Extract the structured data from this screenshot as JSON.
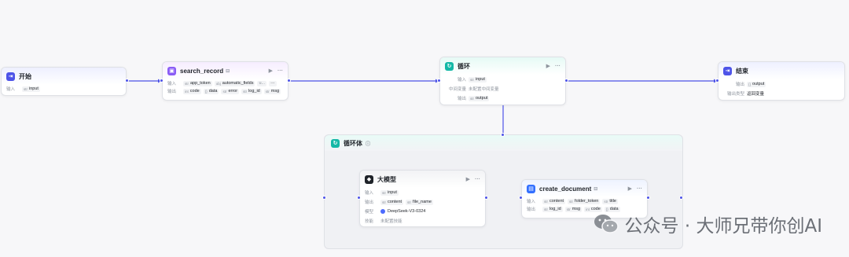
{
  "colors": {
    "edge": "#4d53e8",
    "accent": "#4d53e8"
  },
  "nodes": {
    "start": {
      "title": "开始",
      "input_label": "输入",
      "inputs": [
        {
          "type": "str",
          "name": "input"
        }
      ]
    },
    "search": {
      "title": "search_record",
      "input_label": "输入",
      "output_label": "输出",
      "inputs": [
        {
          "type": "str",
          "name": "app_token"
        },
        {
          "type": "obj",
          "name": "automatic_fields"
        },
        {
          "type": "",
          "name": "u..."
        }
      ],
      "more": "···",
      "outputs": [
        {
          "type": "int",
          "name": "code"
        },
        {
          "type": "{}",
          "name": "data"
        },
        {
          "type": "str",
          "name": "error"
        },
        {
          "type": "str",
          "name": "log_id"
        },
        {
          "type": "str",
          "name": "msg"
        }
      ]
    },
    "loop": {
      "title": "循环",
      "input_label": "输入",
      "mid_label": "中间变量",
      "mid_value": "未配置中间变量",
      "output_label": "输出",
      "inputs": [
        {
          "type": "str",
          "name": "input"
        }
      ],
      "outputs": [
        {
          "type": "str",
          "name": "output"
        }
      ]
    },
    "end": {
      "title": "结束",
      "output_label": "输出",
      "outputs": [
        {
          "type": "{}",
          "name": "output"
        }
      ],
      "return_label": "输出类型",
      "return_value": "返回变量"
    },
    "loop_body": {
      "title": "循环体"
    },
    "llm": {
      "title": "大模型",
      "input_label": "输入",
      "output_label": "输出",
      "model_label": "模型",
      "skill_label": "技能",
      "inputs": [
        {
          "type": "str",
          "name": "input"
        }
      ],
      "outputs": [
        {
          "type": "str",
          "name": "content"
        },
        {
          "type": "str",
          "name": "file_name"
        }
      ],
      "model": "DeepSeek-V3-0324",
      "skill": "未配置技能"
    },
    "doc": {
      "title": "create_document",
      "input_label": "输入",
      "output_label": "输出",
      "inputs": [
        {
          "type": "str",
          "name": "content"
        },
        {
          "type": "str",
          "name": "folder_token"
        },
        {
          "type": "str",
          "name": "title"
        }
      ],
      "outputs": [
        {
          "type": "str",
          "name": "log_id"
        },
        {
          "type": "str",
          "name": "msg"
        },
        {
          "type": "int",
          "name": "code"
        },
        {
          "type": "{}",
          "name": "data"
        }
      ]
    }
  },
  "watermark": {
    "text": "公众号 · 大师兄带你创AI"
  }
}
